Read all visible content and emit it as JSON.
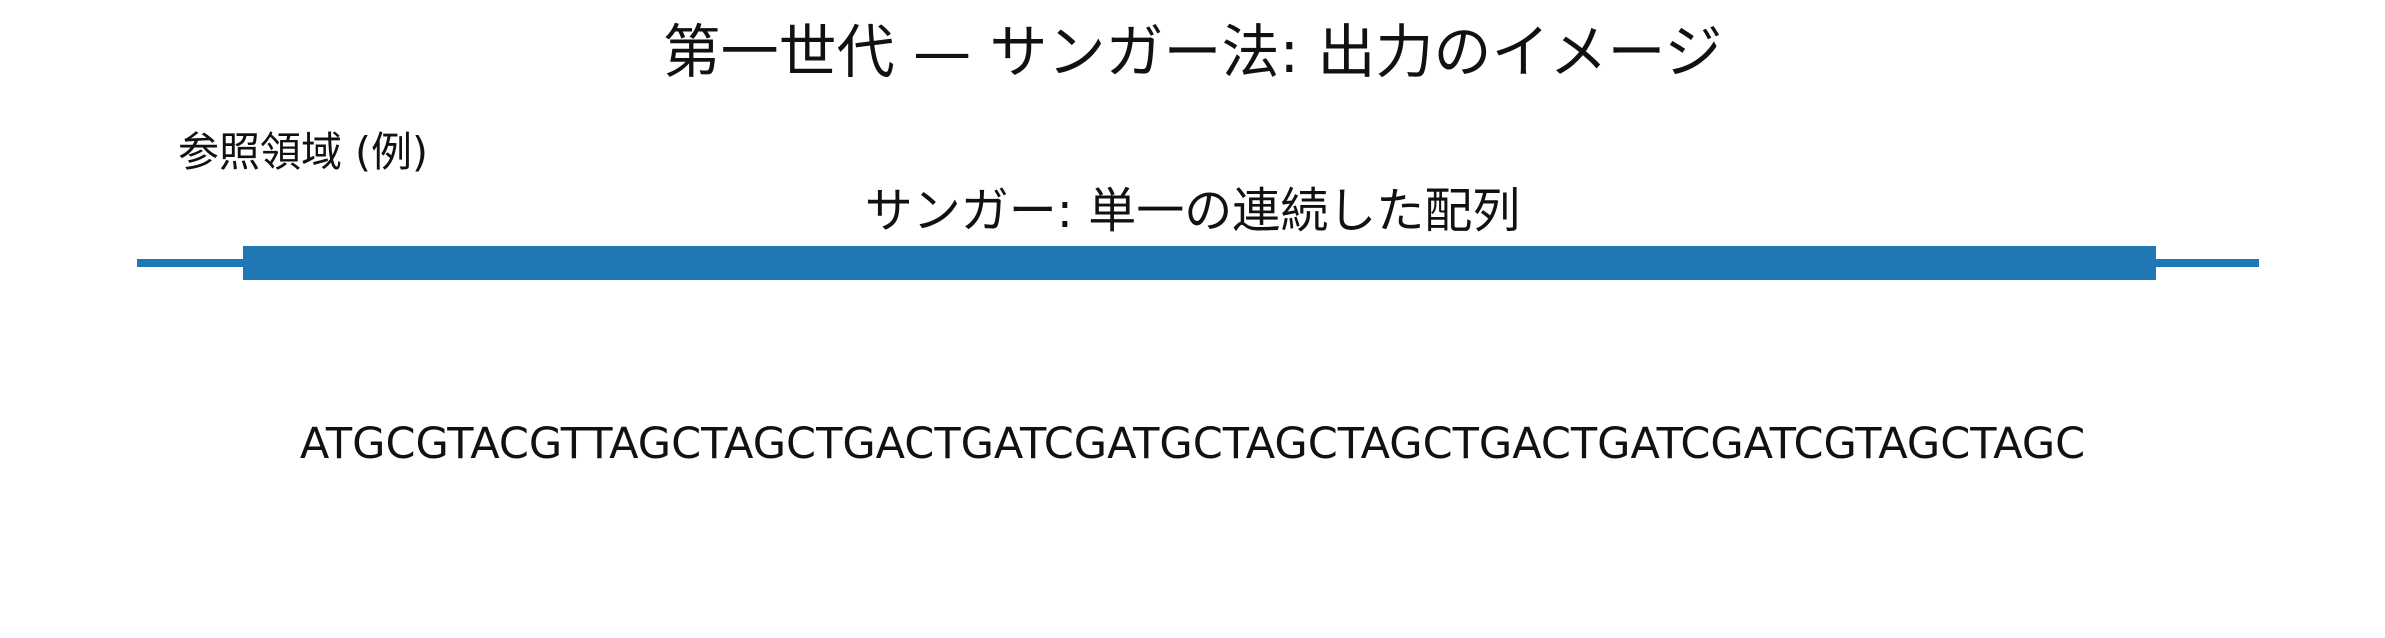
{
  "title": "第一世代 — サンガー法: 出力のイメージ",
  "reference_label": "参照領域 (例)",
  "read_label": "サンガー: 単一の連続した配列",
  "sequence": "ATGCGTACGTTAGCTAGCTGACTGATCGATGCTAGCTAGCTGACTGATCGATCGTAGCTAGC",
  "colors": {
    "reference_line": "#1f77b4",
    "read_bar": "#1f77b4",
    "text": "#111111",
    "background": "#ffffff"
  }
}
